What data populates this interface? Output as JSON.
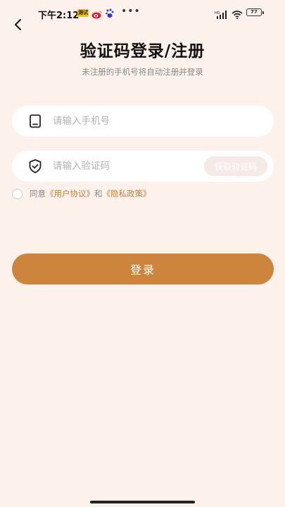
{
  "status_bar": {
    "time": "下午2:12",
    "news_badge": "测试",
    "battery": "77"
  },
  "header": {
    "title": "验证码登录/注册",
    "subtitle": "未注册的手机号将自动注册并登录"
  },
  "form": {
    "phone_placeholder": "请输入手机号",
    "code_placeholder": "请输入验证码",
    "get_code_label": "获取验证码"
  },
  "agreement": {
    "prefix": "同意",
    "user_agreement": "《用户协议》",
    "and": "和",
    "privacy_policy": "《隐私政策》"
  },
  "login_button": "登录",
  "colors": {
    "background": "#fdf1ec",
    "accent": "#cd843c",
    "link": "#c47f38"
  },
  "icons": {
    "back": "chevron-left-icon",
    "phone": "phone-icon",
    "shield": "shield-check-icon"
  }
}
